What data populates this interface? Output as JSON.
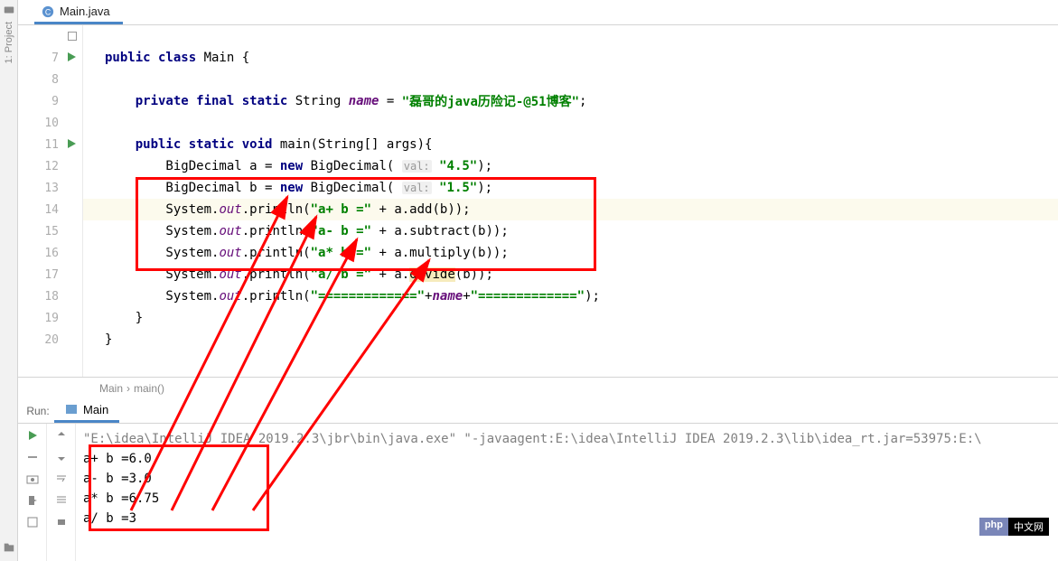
{
  "left_rail": {
    "project_label": "1: Project"
  },
  "tab": {
    "filename": "Main.java"
  },
  "gutter": {
    "lines": [
      "",
      "7",
      "8",
      "9",
      "10",
      "11",
      "12",
      "13",
      "14",
      "15",
      "16",
      "17",
      "18",
      "19",
      "20"
    ]
  },
  "code": {
    "l7": {
      "t1": "public class ",
      "t2": "Main {"
    },
    "l9": {
      "t1": "    private final static ",
      "t2": "String ",
      "name": "name",
      "eq": " = ",
      "str": "\"磊哥的java历险记-@51博客\"",
      "end": ";"
    },
    "l11": {
      "t1": "    public static void ",
      "t2": "main(String[] args){"
    },
    "l12": {
      "t1": "        BigDecimal a = ",
      "nw": "new ",
      "t2": "BigDecimal( ",
      "hint": "val:",
      "str": "\"4.5\"",
      "end": ");"
    },
    "l13": {
      "t1": "        BigDecimal b = ",
      "nw": "new ",
      "t2": "BigDecimal( ",
      "hint": "val:",
      "str": "\"1.5\"",
      "end": ");"
    },
    "l14": {
      "t1": "        System.",
      "out": "out",
      "t2": ".println(",
      "str": "\"a+ b =\"",
      "t3": " + a.add(b));"
    },
    "l15": {
      "t1": "        System.",
      "out": "out",
      "t2": ".println(",
      "str": "\"a- b =\"",
      "t3": " + a.subtract(b));"
    },
    "l16": {
      "t1": "        System.",
      "out": "out",
      "t2": ".println(",
      "str": "\"a* b =\"",
      "t3": " + a.multiply(b));"
    },
    "l17": {
      "t1": "        System.",
      "out": "out",
      "t2": ".println(",
      "str": "\"a/ b =\"",
      "t3": " + a.",
      "div": "divide",
      "t4": "(b));"
    },
    "l18": {
      "t1": "        System.",
      "out": "out",
      "t2": ".println(",
      "s1": "\"=============\"",
      "p": "+",
      "nm": "name",
      "s2": "\"=============\"",
      "end": ");"
    },
    "l19": {
      "t": "    }"
    },
    "l20": {
      "t": "}"
    }
  },
  "breadcrumb": {
    "a": "Main",
    "sep": "›",
    "b": "main()"
  },
  "run": {
    "label": "Run:",
    "tab": "Main",
    "cmd": "\"E:\\idea\\IntelliJ IDEA 2019.2.3\\jbr\\bin\\java.exe\" \"-javaagent:E:\\idea\\IntelliJ IDEA 2019.2.3\\lib\\idea_rt.jar=53975:E:\\",
    "o1": "a+ b =6.0",
    "o2": "a- b =3.0",
    "o3": "a* b =6.75",
    "o4": "a/ b =3"
  },
  "badge": {
    "a": "php",
    "b": "中文网"
  }
}
